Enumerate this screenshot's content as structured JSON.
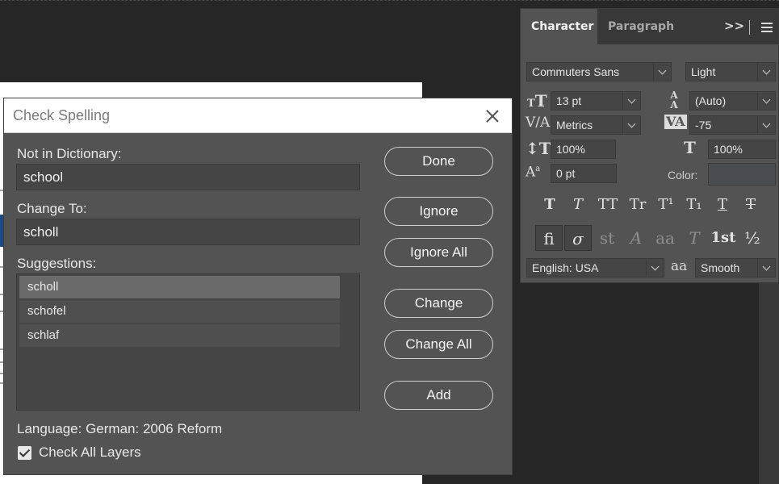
{
  "dialog": {
    "title": "Check Spelling",
    "not_in_dictionary_label": "Not in Dictionary:",
    "not_in_dictionary_value": "school",
    "change_to_label": "Change To:",
    "change_to_value": "scholl",
    "suggestions_label": "Suggestions:",
    "suggestions": [
      "scholl",
      "schofel",
      "schlaf"
    ],
    "selected_suggestion": "scholl",
    "buttons": {
      "done": "Done",
      "ignore": "Ignore",
      "ignore_all": "Ignore All",
      "change": "Change",
      "change_all": "Change All",
      "add": "Add"
    },
    "language_text": "Language: German: 2006 Reform",
    "check_all_layers_label": "Check All Layers",
    "check_all_layers_checked": true
  },
  "character_panel": {
    "tabs": [
      "Character",
      "Paragraph"
    ],
    "active_tab": "Character",
    "more_glyph": ">>",
    "font_family": "Commuters Sans",
    "font_style": "Light",
    "font_size": "13 pt",
    "leading": "(Auto)",
    "kerning": "Metrics",
    "tracking": "-75",
    "vertical_scale": "100%",
    "horizontal_scale": "100%",
    "baseline_shift": "0 pt",
    "color_label": "Color:",
    "color_value": "#494d52",
    "language": "English: USA",
    "antialias_glyph": "aa",
    "antialias": "Smooth",
    "style_glyphs": [
      "T",
      "T",
      "TT",
      "Tr",
      "T¹",
      "T₁",
      "T",
      "T"
    ],
    "opentype_glyphs": [
      "fi",
      "σ",
      "st",
      "A",
      "aa",
      "T",
      "1st",
      "½"
    ]
  },
  "icons": {
    "size_icon": "tT",
    "leading_icon": "A/A",
    "kerning_icon": "V/A",
    "tracking_icon": "VA",
    "vscale_icon": "IT",
    "hscale_icon": "T",
    "baseline_icon": "Aa"
  }
}
